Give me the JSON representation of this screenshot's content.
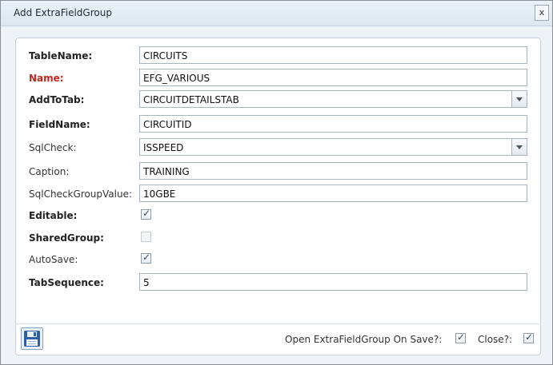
{
  "dialog": {
    "title": "Add ExtraFieldGroup",
    "close_label": "x"
  },
  "fields": {
    "table_name": {
      "label": "TableName:",
      "value": "CIRCUITS"
    },
    "name": {
      "label": "Name:",
      "value": "EFG_VARIOUS"
    },
    "add_to_tab": {
      "label": "AddToTab:",
      "value": "CIRCUITDETAILSTAB"
    },
    "field_name": {
      "label": "FieldName:",
      "value": "CIRCUITID"
    },
    "sql_check": {
      "label": "SqlCheck:",
      "value": "ISSPEED"
    },
    "caption": {
      "label": "Caption:",
      "value": "TRAINING"
    },
    "sql_check_group_value": {
      "label": "SqlCheckGroupValue:",
      "value": "10GBE"
    },
    "editable": {
      "label": "Editable:",
      "checked": true
    },
    "shared_group": {
      "label": "SharedGroup:",
      "checked": false,
      "disabled": true
    },
    "auto_save": {
      "label": "AutoSave:",
      "checked": true
    },
    "tab_sequence": {
      "label": "TabSequence:",
      "value": "5"
    }
  },
  "footer": {
    "open_on_save_label": "Open ExtraFieldGroup On Save?:",
    "open_on_save_checked": true,
    "close_label": "Close?:",
    "close_checked": true
  }
}
